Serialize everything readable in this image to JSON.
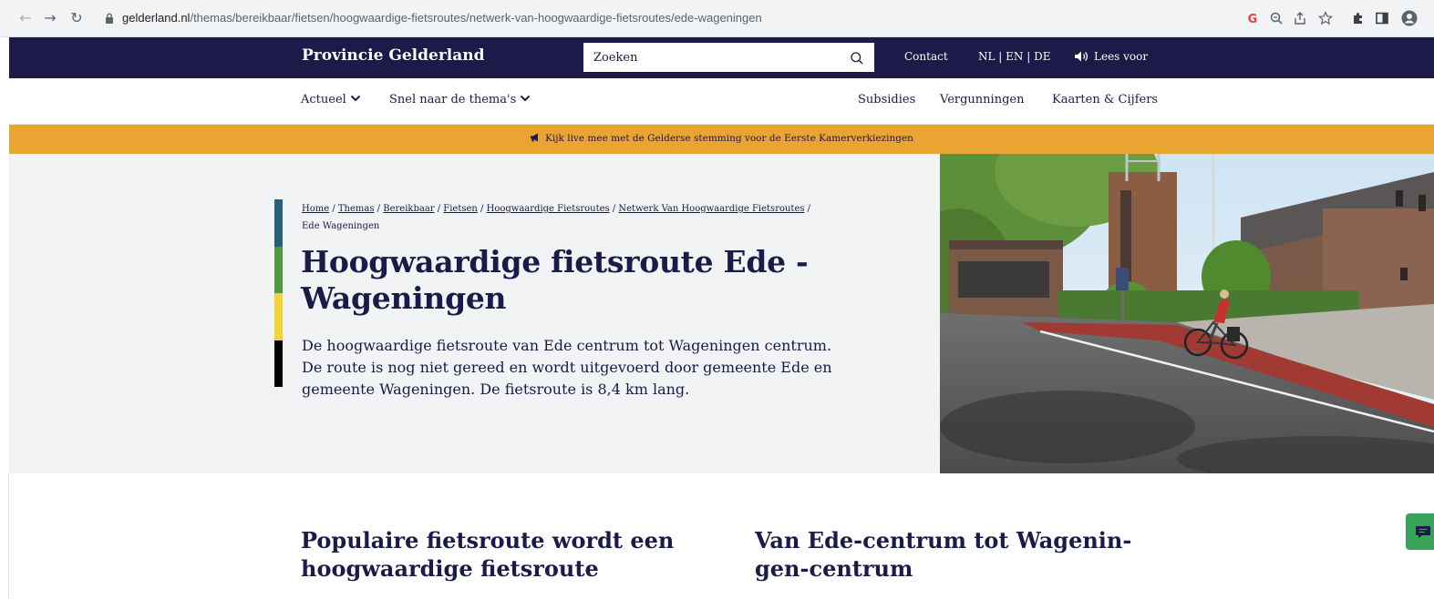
{
  "browser": {
    "url_host": "gelderland.nl",
    "url_path": "/themas/bereikbaar/fietsen/hoogwaardige-fietsroutes/netwerk-van-hoogwaardige-fietsroutes/ede-wageningen",
    "toolbar_icons": [
      "google-icon",
      "zoom-icon",
      "share-icon",
      "bookmark-star-icon",
      "extensions-icon",
      "sidebar-icon",
      "profile-icon"
    ]
  },
  "header": {
    "brand": "Provincie Gelderland",
    "search_placeholder": "Zoeken",
    "contact": "Contact",
    "languages": "NL | EN | DE",
    "read_aloud": "Lees voor",
    "brand_color": "#1b1a48"
  },
  "subnav": {
    "actueel": "Actueel",
    "themas": "Snel naar de thema's",
    "subsidies": "Subsidies",
    "vergunningen": "Vergunningen",
    "kaarten": "Kaarten & Cijfers"
  },
  "banner": {
    "text": "Kijk live mee met de Gelderse stemming voor de Eerste Kamerverkiezingen",
    "color": "#eaa431"
  },
  "breadcrumb": {
    "home": "Home",
    "themas": "Themas",
    "bereikbaar": "Bereikbaar",
    "fietsen": "Fietsen",
    "hoogwaardige": "Hoogwaardige Fietsroutes",
    "netwerk": "Netwerk Van Hoogwaardige Fietsroutes",
    "current": "Ede Wageningen",
    "separator": " / "
  },
  "hero": {
    "title": "Hoogwaardige fietsroute Ede - Wageningen",
    "intro": "De hoogwaardige fietsroute van Ede centrum tot Wageningen centrum. De route is nog niet gereed en wordt uitgevoerd door gemeente Ede en gemeente Wageningen. De fietsroute is 8,4 km lang.",
    "color_bar": [
      "#2a5f7a",
      "#4e9a43",
      "#f2d43a",
      "#000000"
    ]
  },
  "sections": {
    "left_heading": "Populaire fietsroute wordt een hoogwaardige fietsroute",
    "right_heading": "Van Ede-centrum tot Wagenin-gen-centrum"
  },
  "feedback": {
    "icon": "chat-icon",
    "color": "#3aa35a"
  }
}
